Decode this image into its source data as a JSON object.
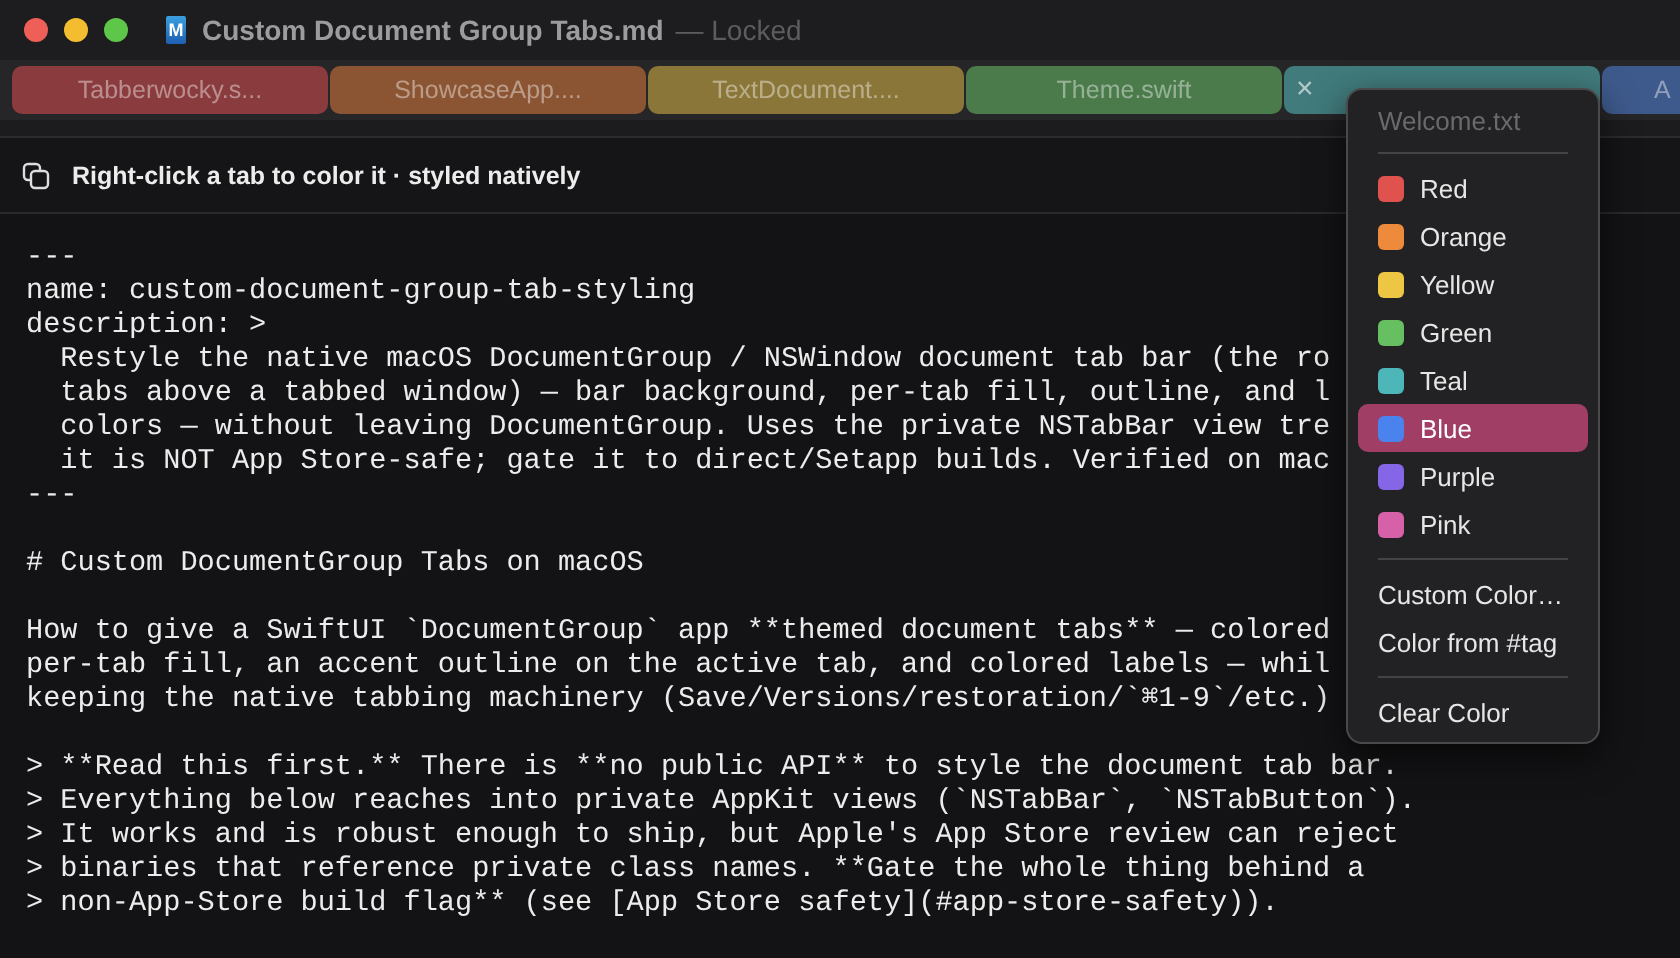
{
  "window": {
    "icon_letter": "M",
    "title": "Custom Document Group Tabs.md",
    "status": "— Locked"
  },
  "tabs": [
    {
      "label": "Tabberwocky.s...",
      "color": "#8a3b3d"
    },
    {
      "label": "ShowcaseApp....",
      "color": "#8b5533"
    },
    {
      "label": "TextDocument....",
      "color": "#8a7638"
    },
    {
      "label": "Theme.swift",
      "color": "#4b7a4b"
    },
    {
      "close": "×",
      "color": "#417b7c"
    },
    {
      "label": "A",
      "color": "#3e5a8c"
    }
  ],
  "toolbar": {
    "hint": "Right-click a tab to color it · styled natively"
  },
  "editor": {
    "blocks": [
      [
        "---",
        "name: custom-document-group-tab-styling",
        "description: >",
        "  Restyle the native macOS DocumentGroup / NSWindow document tab bar (the ro",
        "  tabs above a tabbed window) — bar background, per-tab fill, outline, and l",
        "  colors — without leaving DocumentGroup. Uses the private NSTabBar view tre",
        "  it is NOT App Store-safe; gate it to direct/Setapp builds. Verified on mac",
        "---"
      ],
      [
        "# Custom DocumentGroup Tabs on macOS"
      ],
      [
        "How to give a SwiftUI `DocumentGroup` app **themed document tabs** — colored",
        "per-tab fill, an accent outline on the active tab, and colored labels — whil",
        "keeping the native tabbing machinery (Save/Versions/restoration/`⌘1-9`/etc.)"
      ],
      [
        "> **Read this first.** There is **no public API** to style the document tab bar.",
        "> Everything below reaches into private AppKit views (`NSTabBar`, `NSTabButton`).",
        "> It works and is robust enough to ship, but Apple's App Store review can reject",
        "> binaries that reference private class names. **Gate the whole thing behind a",
        "> non-App-Store build flag** (see [App Store safety](#app-store-safety))."
      ]
    ]
  },
  "context_menu": {
    "header": "Welcome.txt",
    "colors": [
      {
        "label": "Red",
        "color": "#e0524e",
        "selected": false
      },
      {
        "label": "Orange",
        "color": "#ee8a3c",
        "selected": false
      },
      {
        "label": "Yellow",
        "color": "#edc744",
        "selected": false
      },
      {
        "label": "Green",
        "color": "#66c061",
        "selected": false
      },
      {
        "label": "Teal",
        "color": "#4cb6b8",
        "selected": false
      },
      {
        "label": "Blue",
        "color": "#4a82ee",
        "selected": true
      },
      {
        "label": "Purple",
        "color": "#8466e6",
        "selected": false
      },
      {
        "label": "Pink",
        "color": "#d761a8",
        "selected": false
      }
    ],
    "actions": [
      "Custom Color…",
      "Color from #tag"
    ],
    "clear": "Clear Color"
  }
}
